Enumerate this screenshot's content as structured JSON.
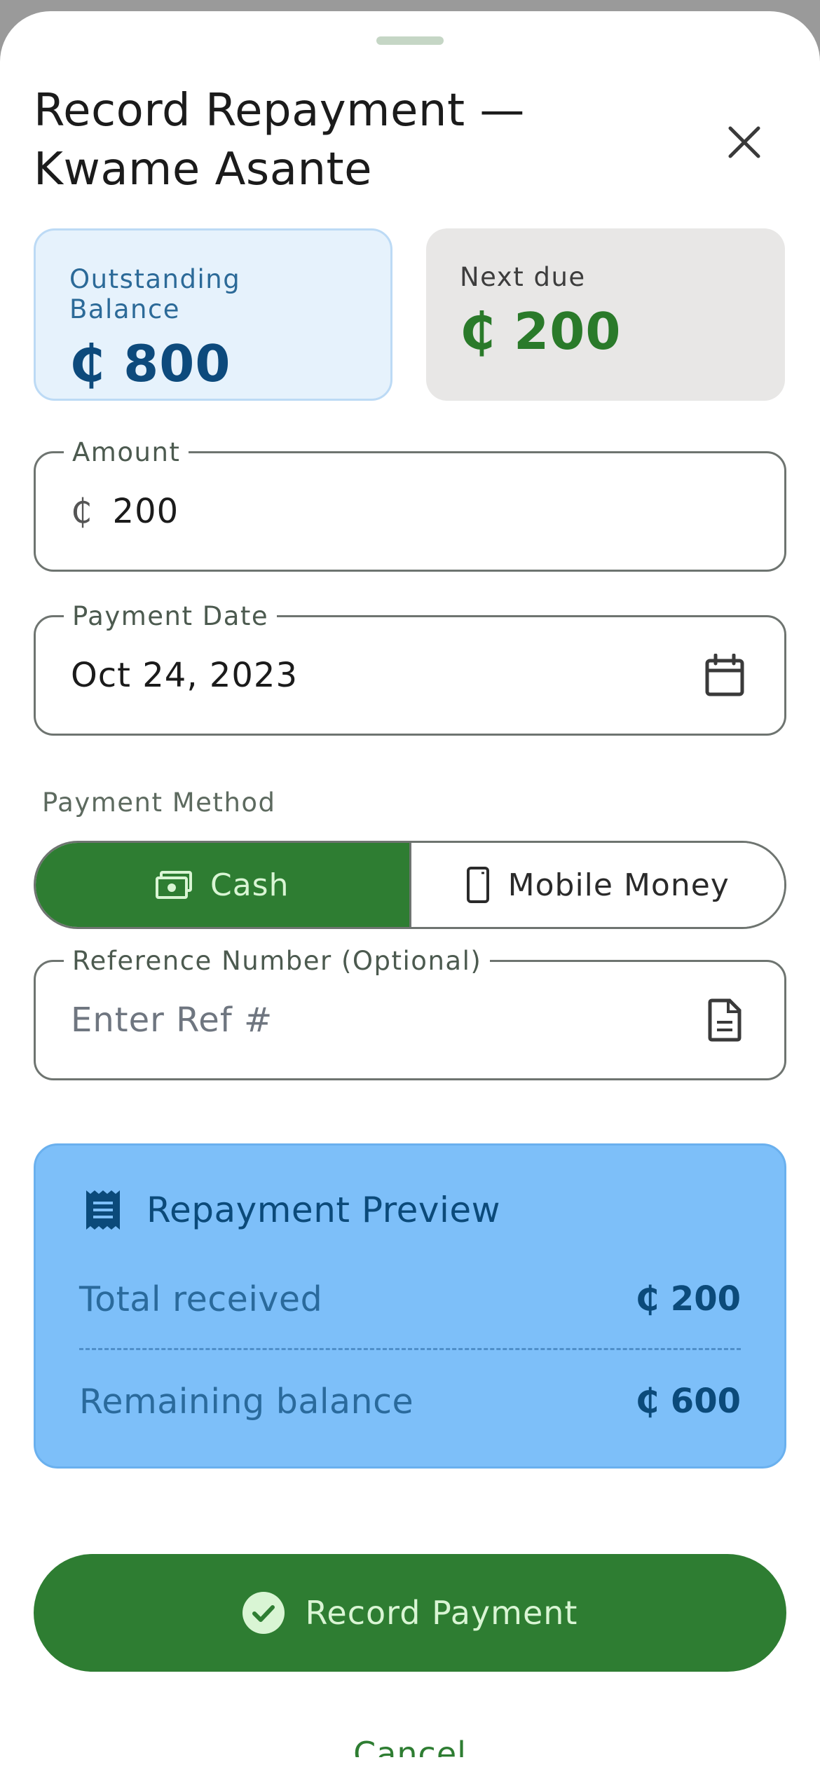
{
  "sheet": {
    "title": "Record Repayment — Kwame Asante"
  },
  "summary": {
    "outstanding_label": "Outstanding Balance",
    "outstanding_value": "₵ 800",
    "next_due_label": "Next due",
    "next_due_value": "₵ 200"
  },
  "form": {
    "amount_label": "Amount",
    "amount_currency": "₵",
    "amount_value": "200",
    "date_label": "Payment Date",
    "date_value": "Oct 24, 2023",
    "method_label": "Payment Method",
    "methods": [
      {
        "label": "Cash",
        "icon": "cash-icon",
        "selected": true
      },
      {
        "label": "Mobile Money",
        "icon": "mobile-phone-icon",
        "selected": false
      }
    ],
    "reference_label": "Reference Number (Optional)",
    "reference_placeholder": "Enter Ref #"
  },
  "preview": {
    "title": "Repayment Preview",
    "icon": "receipt-icon",
    "total_received_label": "Total received",
    "total_received_value": "₵ 200",
    "remaining_label": "Remaining balance",
    "remaining_value": "₵ 600"
  },
  "actions": {
    "primary_label": "Record Payment",
    "cancel_label": "Cancel"
  },
  "colors": {
    "primary_green": "#2e7d32",
    "preview_blue": "#7dbff9",
    "outstanding_bg": "#e6f2fc",
    "next_due_value": "#2a7a2a"
  }
}
